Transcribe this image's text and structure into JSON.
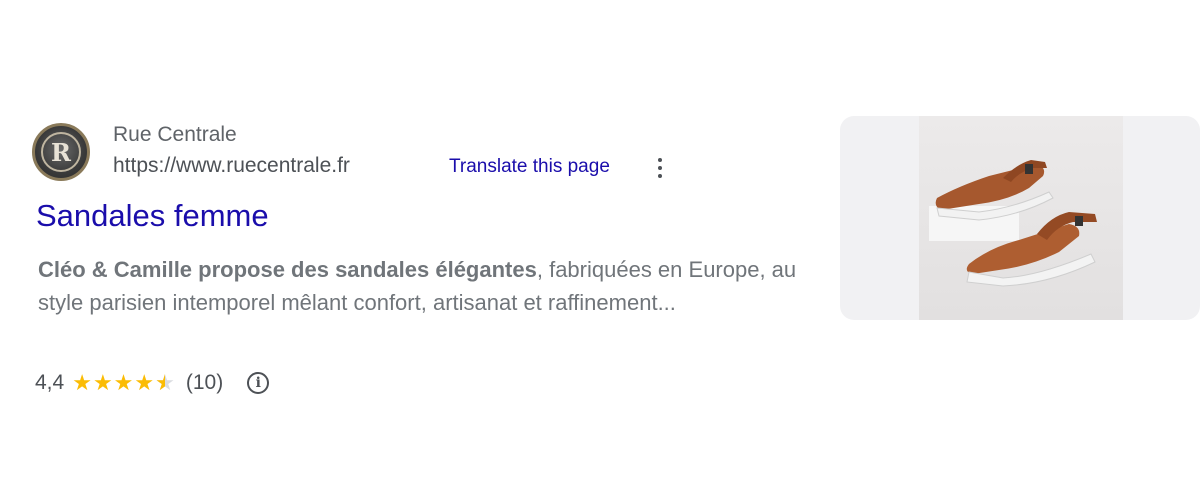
{
  "result": {
    "site_name": "Rue Centrale",
    "site_url": "https://www.ruecentrale.fr",
    "favicon_letter": "R",
    "translate_label": "Translate this page",
    "title": "Sandales femme",
    "snippet_bold": "Cléo & Camille propose des sandales élégantes",
    "snippet_rest": ", fabriquées en Europe, au style parisien intemporel mêlant confort, artisanat et raffinement...",
    "rating": {
      "value_text": "4,4",
      "stars": 4.4,
      "review_count": "(10)"
    },
    "info_glyph": "i",
    "thumbnail_icon": "sandals-photo"
  }
}
